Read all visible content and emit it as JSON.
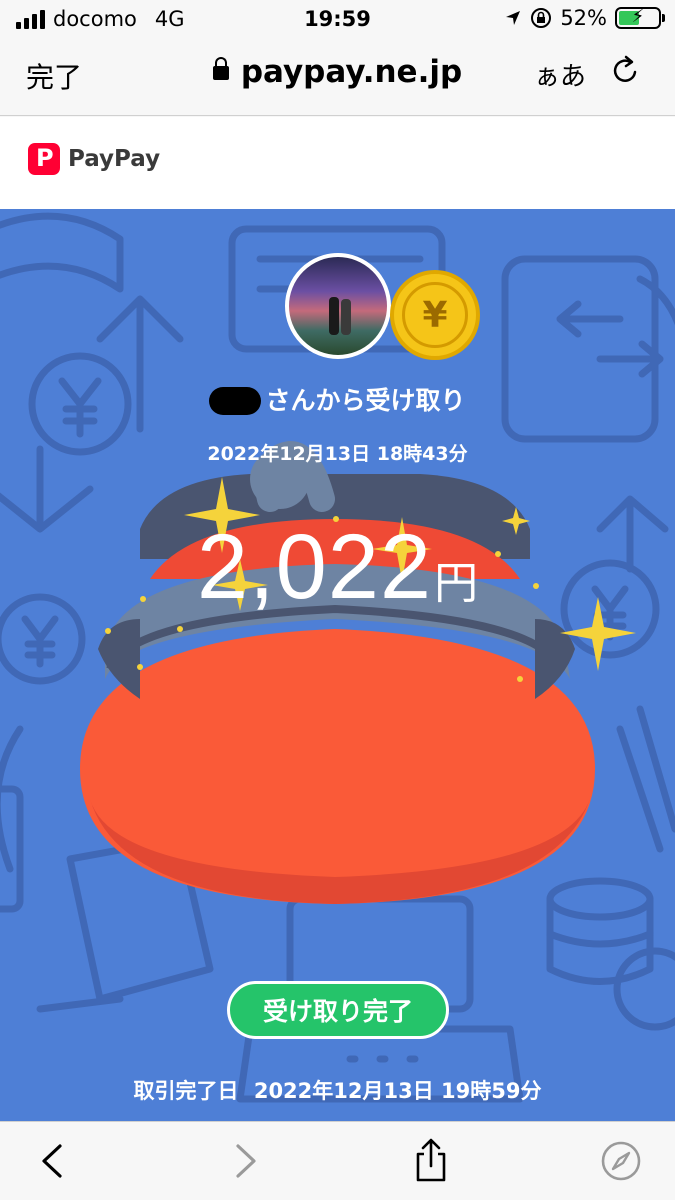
{
  "status_bar": {
    "carrier": "docomo",
    "network": "4G",
    "time": "19:59",
    "battery_percent": "52%",
    "battery_level": 0.52,
    "signal_bars": 4,
    "charging": true
  },
  "browser": {
    "done_label": "完了",
    "url": "paypay.ne.jp",
    "text_size_label": "ぁあ",
    "icons": [
      "lock-icon",
      "reload-icon",
      "back-icon",
      "forward-icon",
      "share-icon",
      "compass-icon"
    ]
  },
  "header": {
    "brand": "PayPay"
  },
  "receipt": {
    "sender_suffix": "さんから受け取り",
    "received_datetime": "2022年12月13日 18時43分",
    "amount": "2,022",
    "currency_unit": "円",
    "status_button": "受け取り完了",
    "completed_label": "取引完了日",
    "completed_datetime": "2022年12月13日 19時59分"
  },
  "colors": {
    "background_blue": "#4e7fd6",
    "purse_red": "#fa5a38",
    "button_green": "#25c46a",
    "coin_gold": "#f5c518",
    "brand_red": "#ff0033"
  }
}
